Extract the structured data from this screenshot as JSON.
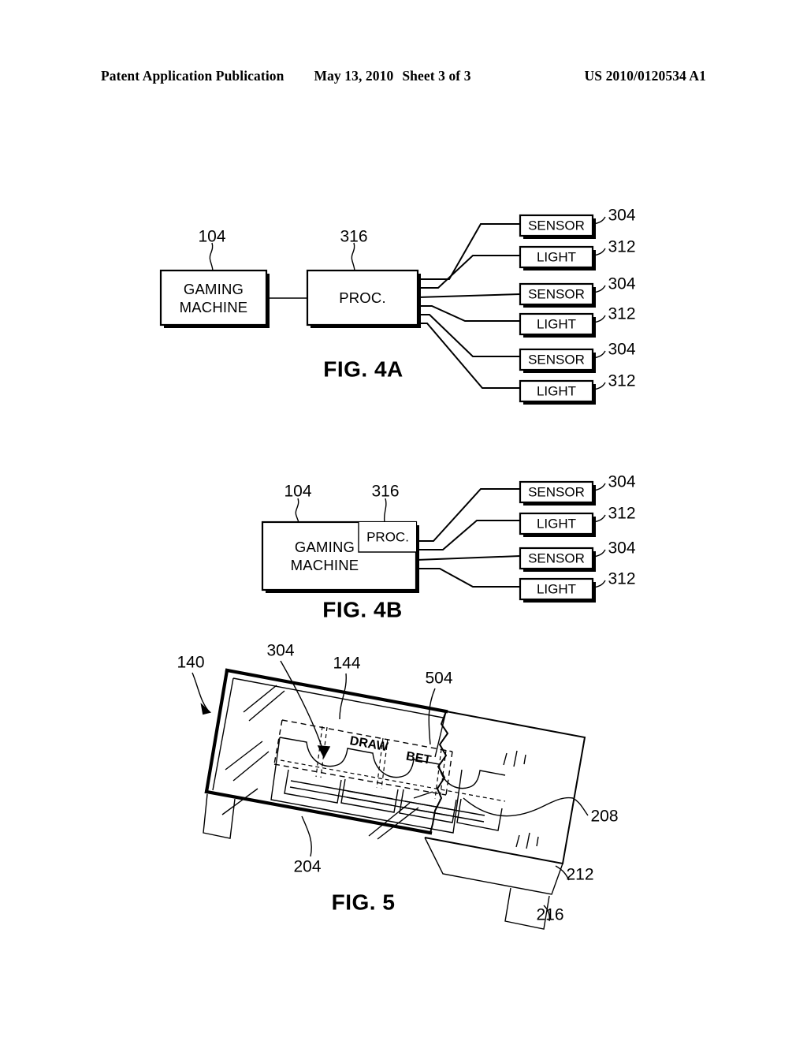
{
  "header": {
    "publication": "Patent Application Publication",
    "date": "May 13, 2010",
    "sheet": "Sheet 3 of 3",
    "pub_number": "US 2010/0120534 A1"
  },
  "figures": [
    {
      "id": "fig4a",
      "caption": "FIG. 4A",
      "blocks": [
        {
          "key": "gaming_machine",
          "label_line1": "GAMING",
          "label_line2": "MACHINE",
          "ref": "104"
        },
        {
          "key": "processor",
          "label_line1": "PROC.",
          "label_line2": "",
          "ref": "316"
        }
      ],
      "peripherals": [
        {
          "key": "sensor_1",
          "label": "SENSOR",
          "ref": "304"
        },
        {
          "key": "light_1",
          "label": "LIGHT",
          "ref": "312"
        },
        {
          "key": "sensor_2",
          "label": "SENSOR",
          "ref": "304"
        },
        {
          "key": "light_2",
          "label": "LIGHT",
          "ref": "312"
        },
        {
          "key": "sensor_3",
          "label": "SENSOR",
          "ref": "304"
        },
        {
          "key": "light_3",
          "label": "LIGHT",
          "ref": "312"
        }
      ]
    },
    {
      "id": "fig4b",
      "caption": "FIG. 4B",
      "blocks": [
        {
          "key": "gaming_machine",
          "label_line1": "GAMING",
          "label_line2": "MACHINE",
          "ref": "104"
        },
        {
          "key": "processor",
          "label_line1": "PROC.",
          "label_line2": "",
          "ref": "316"
        }
      ],
      "peripherals": [
        {
          "key": "sensor_1",
          "label": "SENSOR",
          "ref": "304"
        },
        {
          "key": "light_1",
          "label": "LIGHT",
          "ref": "312"
        },
        {
          "key": "sensor_2",
          "label": "SENSOR",
          "ref": "304"
        },
        {
          "key": "light_2",
          "label": "LIGHT",
          "ref": "312"
        }
      ]
    },
    {
      "id": "fig5",
      "caption": "FIG. 5",
      "button_labels": [
        {
          "key": "draw",
          "label": "DRAW"
        },
        {
          "key": "bet",
          "label": "BET"
        }
      ],
      "ref_numbers": [
        {
          "key": "cabinet",
          "ref": "140"
        },
        {
          "key": "sensor",
          "ref": "304"
        },
        {
          "key": "button_deck",
          "ref": "144"
        },
        {
          "key": "break_line",
          "ref": "504"
        },
        {
          "key": "front_edge",
          "ref": "204"
        },
        {
          "key": "side_panel",
          "ref": "208"
        },
        {
          "key": "lower_panel",
          "ref": "212"
        },
        {
          "key": "foot",
          "ref": "216"
        }
      ]
    }
  ]
}
